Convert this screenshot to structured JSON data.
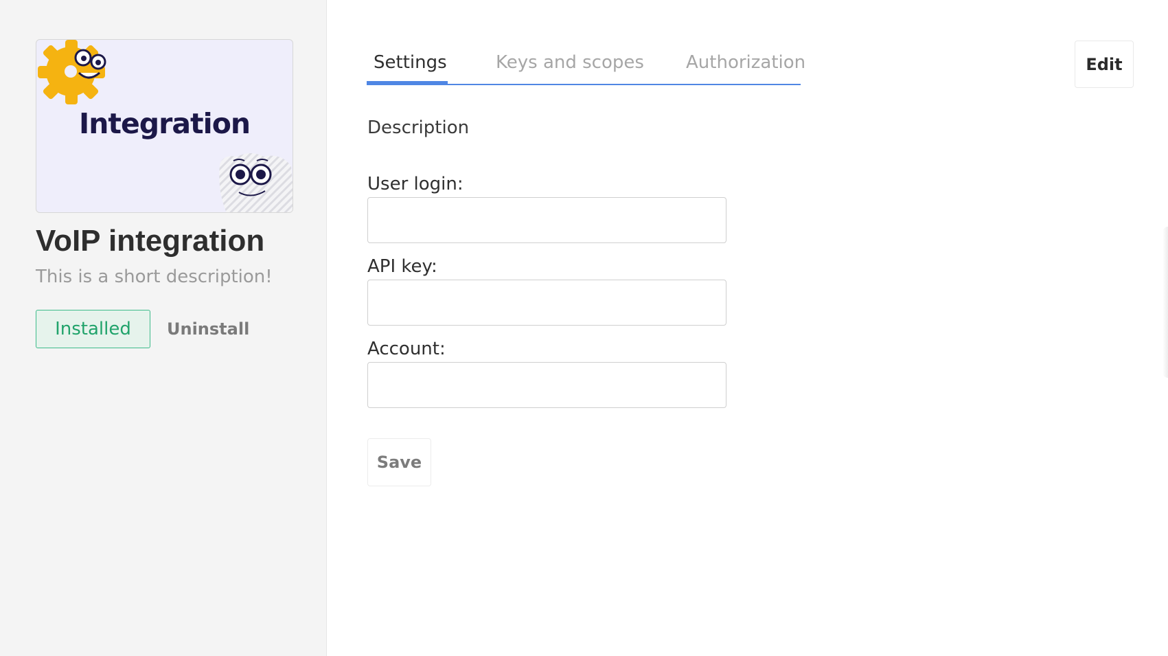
{
  "sidebar": {
    "cover": {
      "title": "Integration",
      "background": "#efeefb",
      "icons": [
        "gear-mascot-icon",
        "cloud-mascot-icon"
      ]
    },
    "app_title": "VoIP integration",
    "app_description": "This is a short description!",
    "installed_label": "Installed",
    "uninstall_label": "Uninstall"
  },
  "header": {
    "tabs": [
      {
        "label": "Settings",
        "active": true
      },
      {
        "label": "Keys and scopes",
        "active": false
      },
      {
        "label": "Authorization",
        "active": false
      }
    ],
    "edit_label": "Edit"
  },
  "main": {
    "section_heading": "Description",
    "fields": [
      {
        "label": "User login:",
        "value": "",
        "placeholder": ""
      },
      {
        "label": "API key:",
        "value": "",
        "placeholder": ""
      },
      {
        "label": "Account:",
        "value": "",
        "placeholder": ""
      }
    ],
    "save_label": "Save"
  },
  "colors": {
    "accent": "#4f86e4",
    "installed_text": "#21a36b",
    "installed_bg": "#e6f3ec",
    "sidebar_bg": "#f4f4f4"
  }
}
